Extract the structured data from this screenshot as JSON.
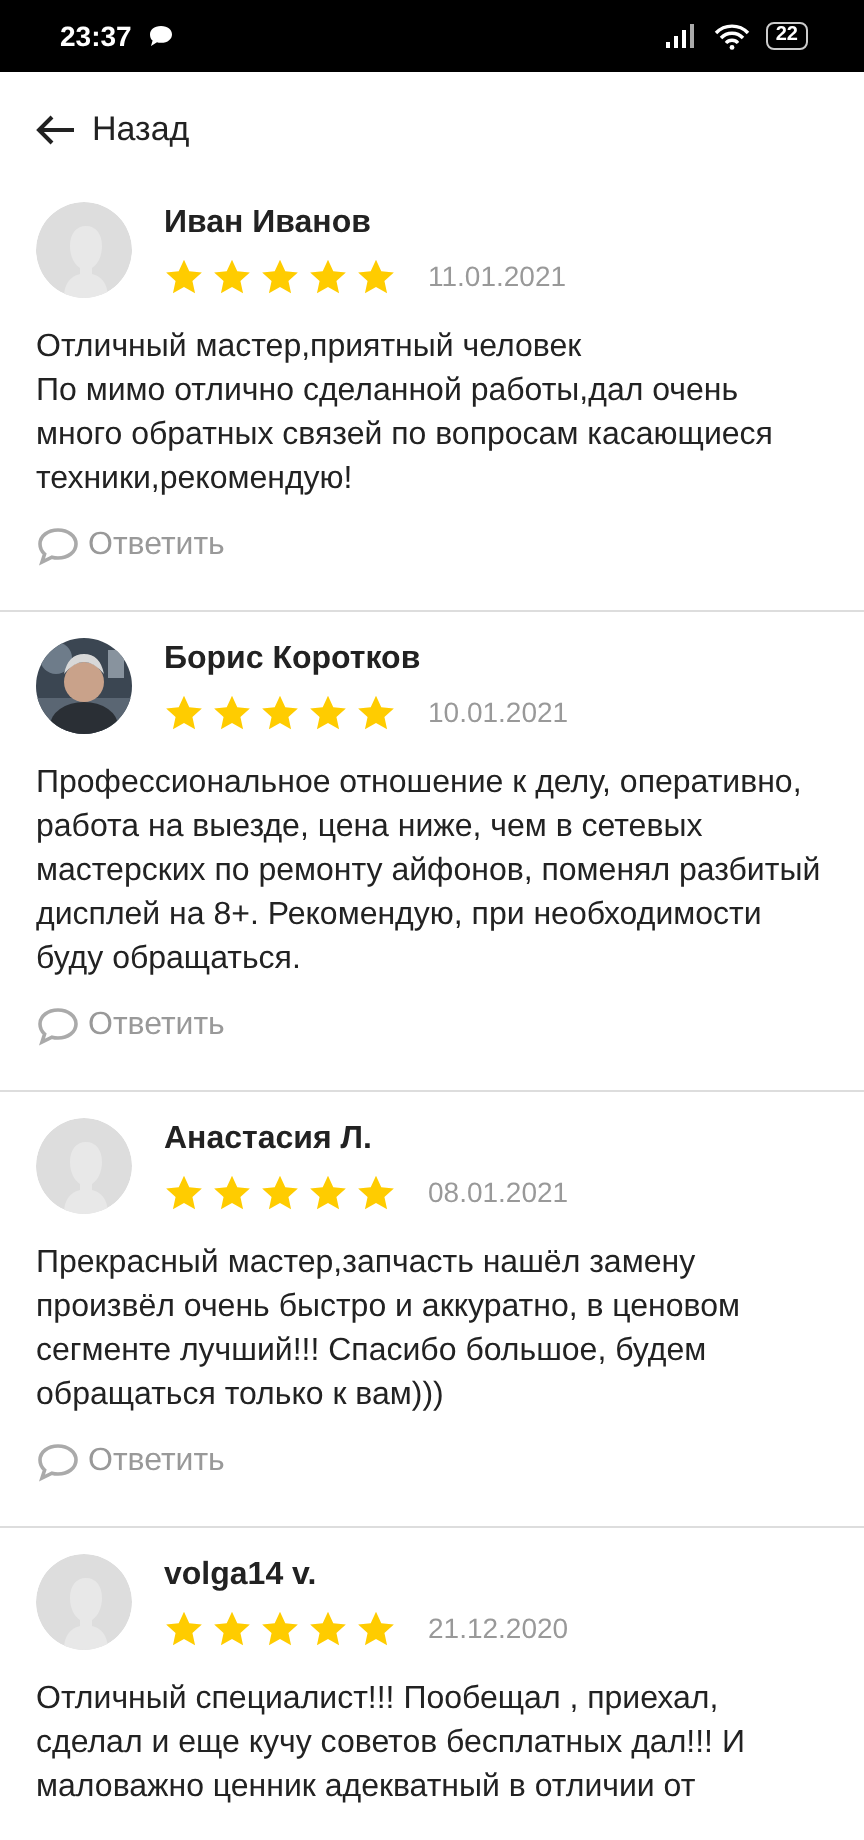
{
  "status_bar": {
    "time": "23:37",
    "battery": "22"
  },
  "header": {
    "back_label": "Назад"
  },
  "reviews": [
    {
      "author": "Иван Иванов",
      "photo": false,
      "stars": 5,
      "date": "11.01.2021",
      "text": "Отличный мастер,приятный человек\nПо мимо отлично сделанной работы,дал очень много обратных связей по вопросам касающиеся техники,рекомендую!",
      "reply_label": "Ответить"
    },
    {
      "author": "Борис Коротков",
      "photo": true,
      "stars": 5,
      "date": "10.01.2021",
      "text": "Профессиональное отношение к делу, оперативно, работа на выезде, цена ниже, чем в сетевых мастерских по ремонту айфонов, поменял разбитый дисплей на 8+. Рекомендую, при необходимости буду обращаться.",
      "reply_label": "Ответить"
    },
    {
      "author": "Анастасия Л.",
      "photo": false,
      "stars": 5,
      "date": "08.01.2021",
      "text": "Прекрасный мастер,запчасть нашёл замену произвёл очень быстро и аккуратно, в ценовом сегменте лучший!!! Спасибо большое, будем обращаться только к вам)))",
      "reply_label": "Ответить"
    },
    {
      "author": "volga14 v.",
      "photo": false,
      "stars": 5,
      "date": "21.12.2020",
      "text": "Отличный специалист!!! Пообещал , приехал, сделал и еще кучу советов бесплатных дал!!! И маловажно ценник адекватный в отличии от"
    }
  ]
}
